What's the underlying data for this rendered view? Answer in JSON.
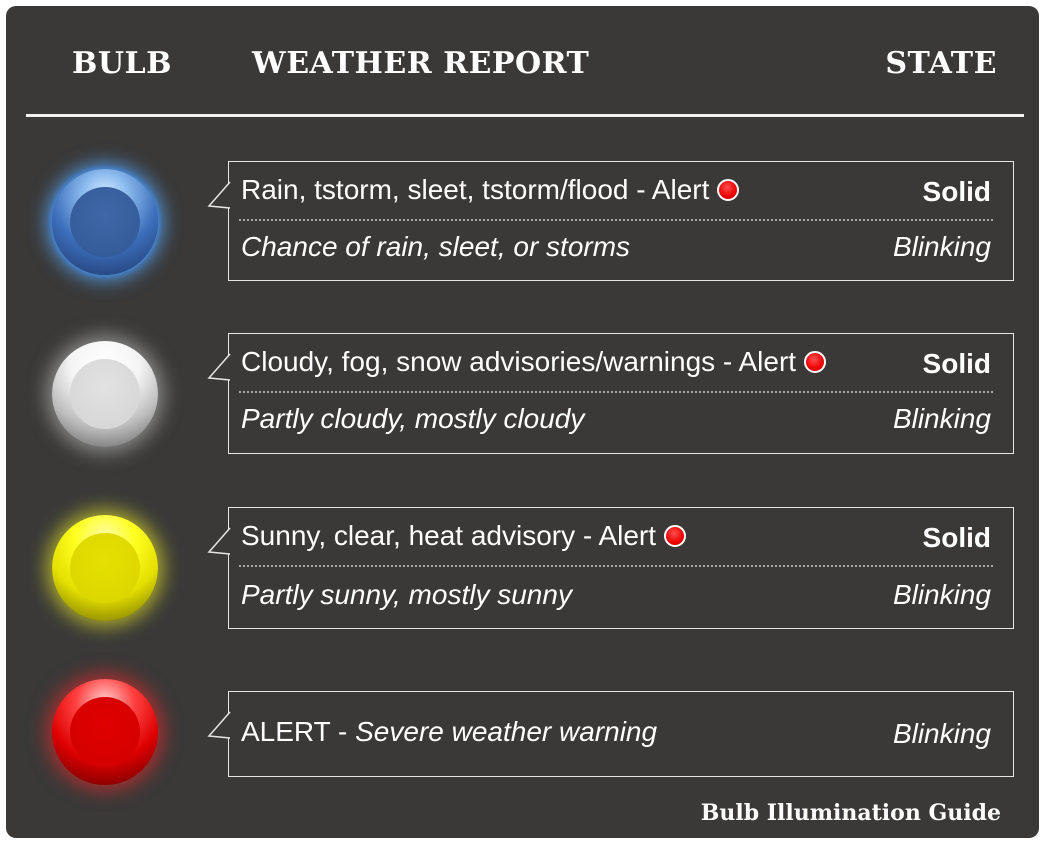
{
  "header": {
    "bulb": "BULB",
    "weather_report": "WEATHER REPORT",
    "state": "STATE"
  },
  "rows": [
    {
      "bulb_color": "blue",
      "line1": "Rain, tstorm, sleet, tstorm/flood - Alert",
      "line1_state": "Solid",
      "line2": "Chance of rain, sleet, or storms",
      "line2_state": "Blinking",
      "alert_dot": true
    },
    {
      "bulb_color": "white",
      "line1": "Cloudy, fog, snow advisories/warnings - Alert",
      "line1_state": "Solid",
      "line2": "Partly cloudy, mostly cloudy",
      "line2_state": "Blinking",
      "alert_dot": true
    },
    {
      "bulb_color": "yellow",
      "line1": "Sunny, clear, heat advisory - Alert",
      "line1_state": "Solid",
      "line2": "Partly sunny, mostly sunny",
      "line2_state": "Blinking",
      "alert_dot": true
    },
    {
      "bulb_color": "red",
      "line1_prefix": "ALERT - ",
      "line1_italic": "Severe weather warning",
      "line1_state": "Blinking"
    }
  ],
  "footer": "Bulb Illumination Guide",
  "colors": {
    "panel_background": "#3a3938",
    "text": "#ffffff",
    "alert_dot": "#ee0000",
    "bulb_blue": "#355d9c",
    "bulb_white": "#d6d6d6",
    "bulb_yellow": "#dcd600",
    "bulb_red": "#d40000"
  },
  "icons": [
    "alert-dot-icon",
    "bulb-icon"
  ]
}
